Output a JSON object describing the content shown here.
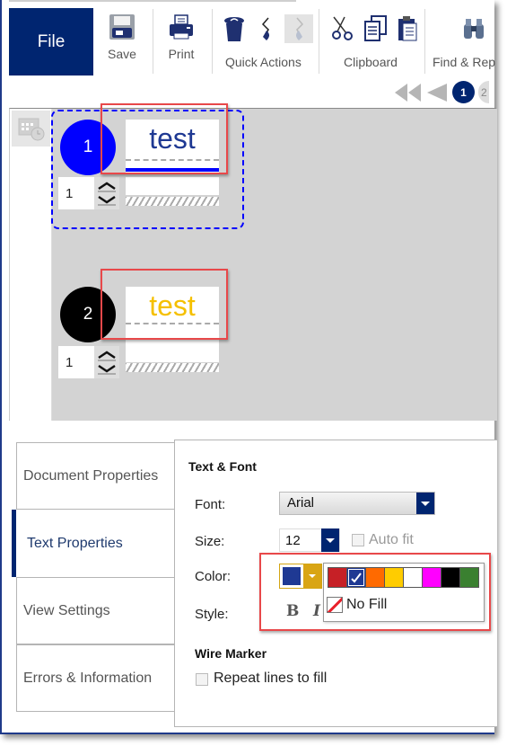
{
  "ribbon": {
    "file_label": "File",
    "save_label": "Save",
    "print_label": "Print",
    "quick_actions_label": "Quick Actions",
    "clipboard_label": "Clipboard",
    "find_label": "Find & Rep"
  },
  "pagenav": {
    "current_page": "1",
    "next_page": "2"
  },
  "labels": [
    {
      "number": "1",
      "circle_color": "#0000ff",
      "text": "test",
      "text_color": "#1f3993",
      "quantity": "1",
      "selected": true
    },
    {
      "number": "2",
      "circle_color": "#000000",
      "text": "test",
      "text_color": "#f5c000",
      "quantity": "1",
      "selected": false
    }
  ],
  "tabs": [
    {
      "label": "Document Properties",
      "active": false
    },
    {
      "label": "Text Properties",
      "active": true
    },
    {
      "label": "View Settings",
      "active": false
    },
    {
      "label": "Errors & Information",
      "active": false
    }
  ],
  "text_font": {
    "section_title": "Text & Font",
    "font_label": "Font:",
    "font_value": "Arial",
    "size_label": "Size:",
    "size_value": "12",
    "autofit_label": "Auto fit",
    "autofit_checked": false,
    "color_label": "Color:",
    "current_color": "#1f3993",
    "style_label": "Style:",
    "bold_glyph": "B",
    "italic_glyph": "I"
  },
  "palette": {
    "colors": [
      "#c62026",
      "#1f3993",
      "#ff6a00",
      "#ffcc00",
      "#ffffff",
      "#ff00ff",
      "#000000",
      "#3a8030"
    ],
    "selected_index": 1,
    "no_fill_label": "No Fill"
  },
  "wire_marker": {
    "section_title": "Wire Marker",
    "repeat_label": "Repeat lines to fill",
    "repeat_checked": false
  }
}
